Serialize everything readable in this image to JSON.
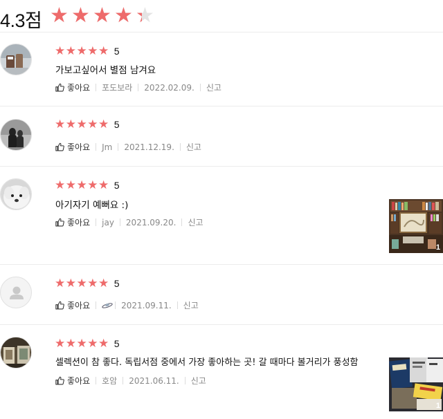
{
  "summary": {
    "score": "4.3점",
    "rating": 4.3,
    "max": 5
  },
  "reviews": [
    {
      "stars": "★★★★★",
      "rating": "5",
      "text": "가보고싶어서 별점 남겨요",
      "like": "좋아요",
      "author": "포도보라",
      "date": "2022.02.09.",
      "report": "신고"
    },
    {
      "stars": "★★★★★",
      "rating": "5",
      "text": "",
      "like": "좋아요",
      "author": "Jm",
      "date": "2021.12.19.",
      "report": "신고"
    },
    {
      "stars": "★★★★★",
      "rating": "5",
      "text": "아기자기 예뻐요 :)",
      "like": "좋아요",
      "author": "jay",
      "date": "2021.09.20.",
      "report": "신고",
      "photo_count": "1"
    },
    {
      "stars": "★★★★★",
      "rating": "5",
      "text": "",
      "like": "좋아요",
      "author": "",
      "date": "2021.09.11.",
      "report": "신고"
    },
    {
      "stars": "★★★★★",
      "rating": "5",
      "text": "셀렉션이 참 좋다. 독립서점 중에서 가장 좋아하는 곳! 갈 때마다 볼거리가 풍성함",
      "like": "좋아요",
      "author": "호암",
      "date": "2021.06.11.",
      "report": "신고",
      "photo_count": "1"
    }
  ],
  "colors": {
    "star": "#ee6b6b",
    "star_empty": "#e4e4e4",
    "meta": "#888888"
  },
  "icons": {
    "like": "thumbs-up-icon",
    "default_avatar": "user-silhouette-icon",
    "author_badge": "ufo-icon"
  }
}
